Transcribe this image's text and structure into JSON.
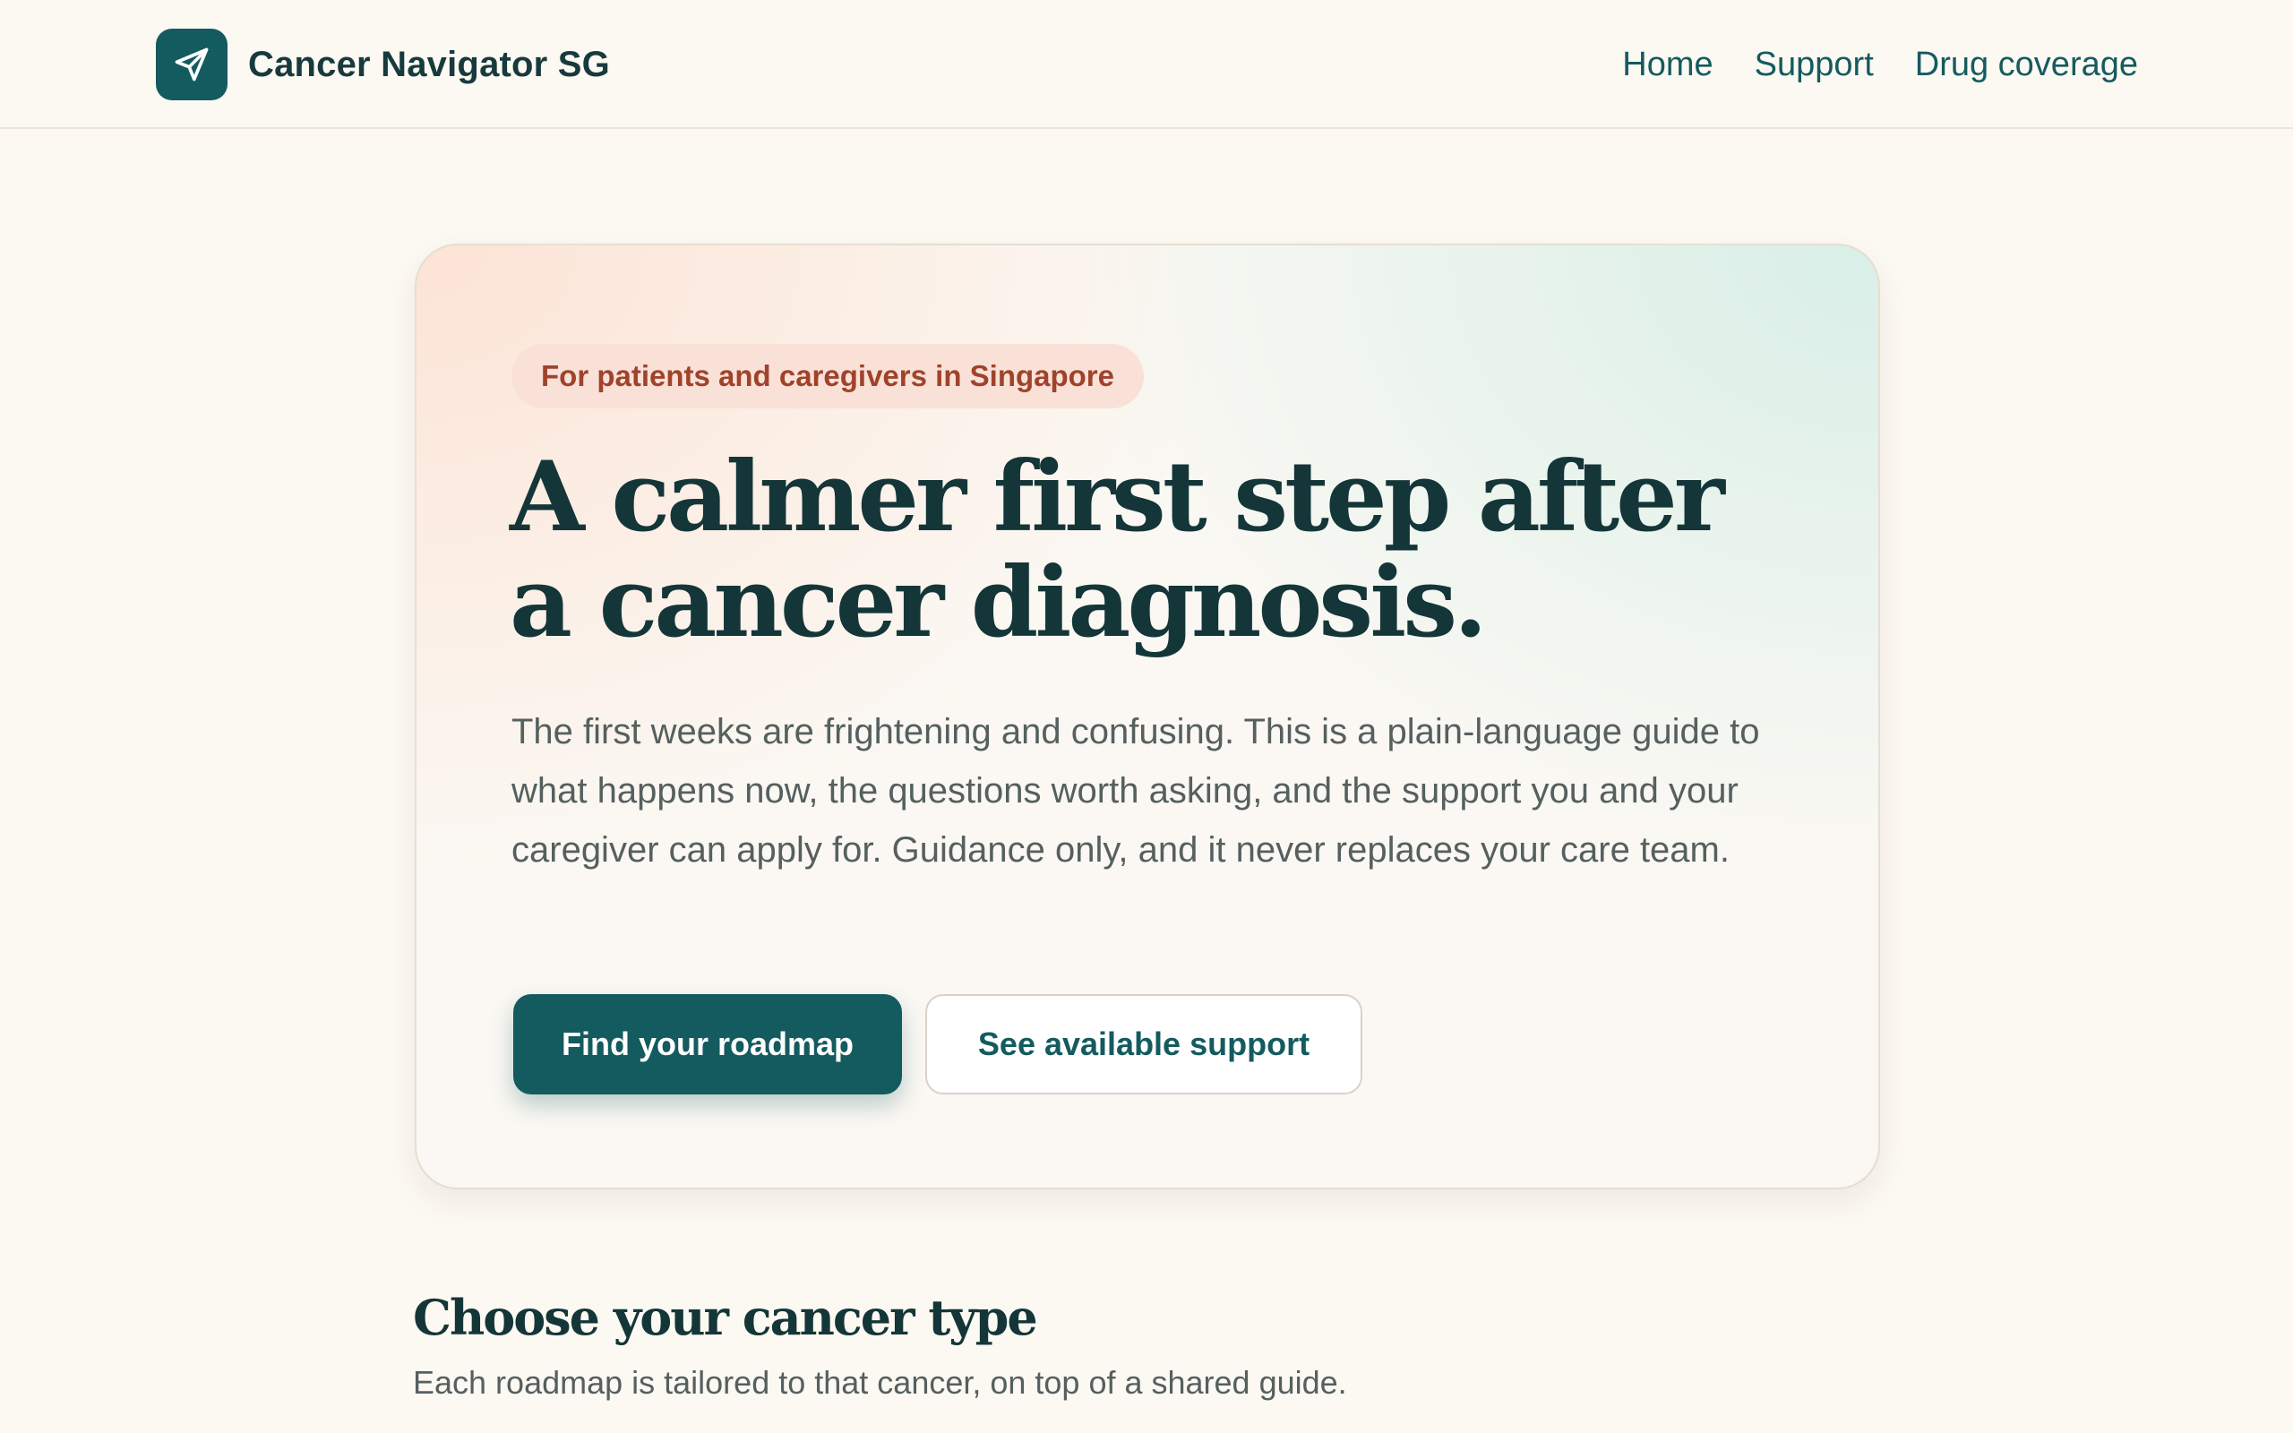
{
  "header": {
    "brand_name": "Cancer Navigator SG",
    "brand_icon": "paper-plane-icon",
    "nav": [
      {
        "label": "Home"
      },
      {
        "label": "Support"
      },
      {
        "label": "Drug coverage"
      }
    ]
  },
  "hero": {
    "eyebrow": "For patients and caregivers in Singapore",
    "headline_line1": "A calmer first step after",
    "headline_line2": "a cancer diagnosis.",
    "lead": "The first weeks are frightening and confusing. This is a plain-language guide to what happens now, the questions worth asking, and the support you and your caregiver can apply for. Guidance only, and it never replaces your care team.",
    "primary_cta": "Find your roadmap",
    "secondary_cta": "See available support"
  },
  "section": {
    "title": "Choose your cancer type",
    "subtitle": "Each roadmap is tailored to that cancer, on top of a shared guide."
  },
  "colors": {
    "accent": "#145b5f",
    "background": "#fcf8f2",
    "eyebrow_text": "#a0432b",
    "eyebrow_bg": "#f9e1d8"
  }
}
